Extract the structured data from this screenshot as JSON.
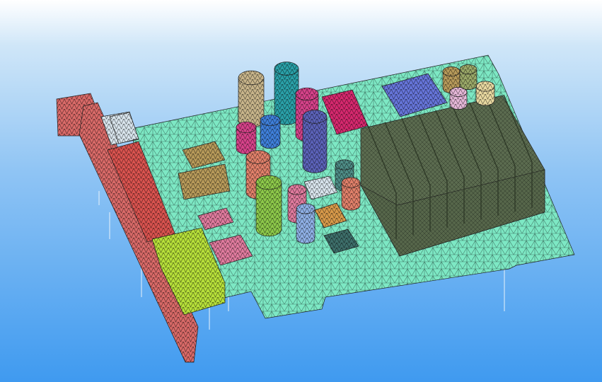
{
  "scene": {
    "subject": "graphics-card-fe-mesh",
    "colors": {
      "background_top": "#ffffff",
      "background_bottom": "#3f9af0",
      "pcb": "#7de8c4",
      "mesh_line": "#000000",
      "bracket": "#d96a68",
      "port_block": "#d9534f",
      "heatsink": "#5b6b4f",
      "gpu_chip": "#6675d9",
      "magenta_chip": "#d6286e",
      "yellow_block": "#b7e03a",
      "cap_tan": "#c7b48a",
      "cap_teal": "#2aa0a8",
      "cap_pink": "#d6428a",
      "cap_navy": "#5b62b8",
      "cap_blue": "#3f7fd9",
      "cap_green": "#8cc84a",
      "cap_salmon": "#e0806a",
      "chip_pink": "#e07b9e",
      "chip_orange": "#d89a4a",
      "chip_dark": "#3d6e6a",
      "chip_brown": "#b79a5a",
      "grid_white": "#d8e4ec"
    }
  }
}
